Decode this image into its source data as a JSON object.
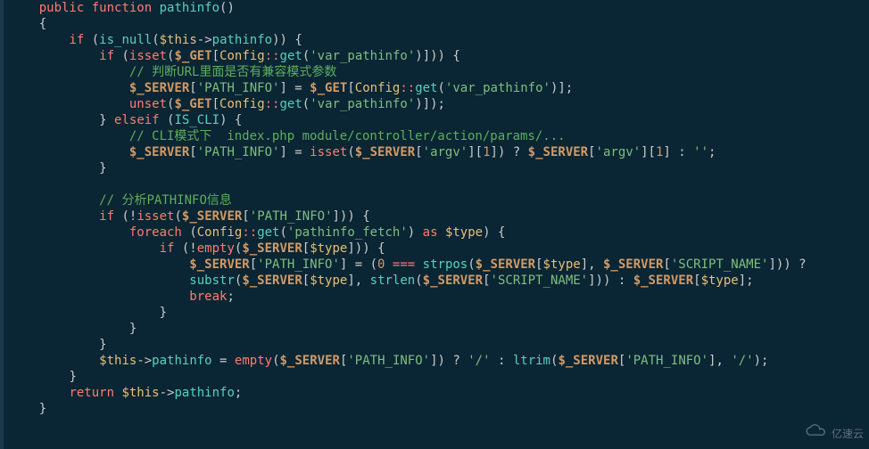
{
  "line01": "public",
  "line01b": "function",
  "line01c": "pathinfo",
  "line02": "{",
  "cmt1": "// 判断URL里面是否有兼容模式参数",
  "cmt2": "// CLI模式下  index.php module/controller/action/params/...",
  "cmt3": "// 分析PATHINFO信息",
  "kw_if": "if",
  "kw_elseif": "elseif",
  "kw_foreach": "foreach",
  "kw_as": "as",
  "kw_break": "break",
  "kw_return": "return",
  "fn_is_null": "is_null",
  "fn_isset": "isset",
  "fn_unset": "unset",
  "fn_empty": "empty",
  "fn_strpos": "strpos",
  "fn_substr": "substr",
  "fn_strlen": "strlen",
  "fn_ltrim": "ltrim",
  "fn_get": "get",
  "cls_config": "Config",
  "const_iscli": "IS_CLI",
  "var_this": "$this",
  "var_get": "$_GET",
  "var_server": "$_SERVER",
  "var_type": "$type",
  "mem_pathinfo": "pathinfo",
  "str_var_pathinfo": "'var_pathinfo'",
  "str_path_info": "'PATH_INFO'",
  "str_argv": "'argv'",
  "str_pathinfo_fetch": "'pathinfo_fetch'",
  "str_script_name": "'SCRIPT_NAME'",
  "str_slash": "'/'",
  "str_empty": "''",
  "num0": "0",
  "num1": "1",
  "triple_eq": "===",
  "watermark_text": "亿速云"
}
